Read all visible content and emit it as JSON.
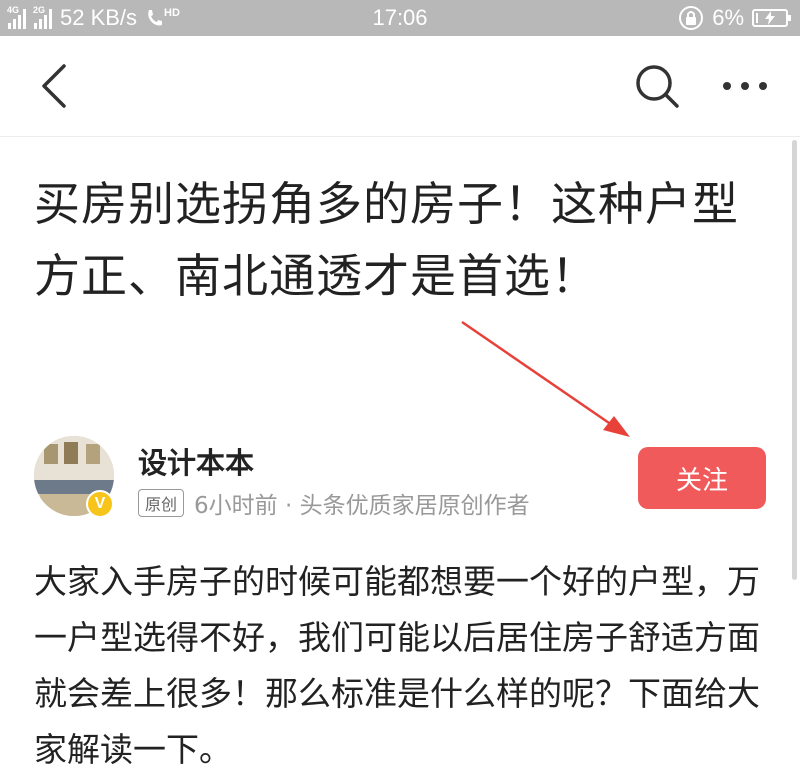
{
  "status_bar": {
    "network_label_1": "4G",
    "network_label_2": "2G",
    "speed": "52 KB/s",
    "hd_label": "HD",
    "time": "17:06",
    "battery_percent": "6%",
    "battery_level": 0.06
  },
  "toolbar": {
    "back_icon": "back-arrow-icon",
    "search_icon": "search-icon",
    "more_icon": "more-icon"
  },
  "article": {
    "title": "买房别选拐角多的房子！这种户型方正、南北通透才是首选！",
    "author": {
      "name": "设计本本",
      "verified_badge": "V",
      "original_tag": "原创",
      "meta": "6小时前 · 头条优质家居原创作者"
    },
    "follow_label": "关注",
    "body": "大家入手房子的时候可能都想要一个好的户型，万一户型选得不好，我们可能以后居住房子舒适方面就会差上很多！那么标准是什么样的呢？下面给大家解读一下。"
  },
  "colors": {
    "accent": "#f15a5a",
    "status_bar": "#b8b8b8",
    "badge": "#f7c41a"
  }
}
